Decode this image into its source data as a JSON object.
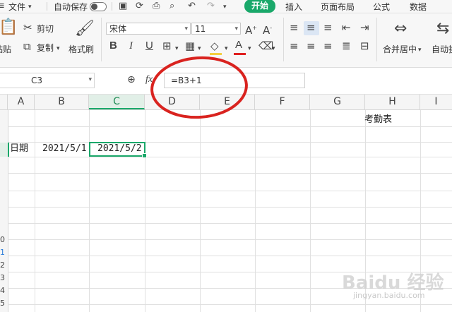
{
  "menubar": {
    "file": "文件",
    "autosave": "自动保存",
    "tabs": [
      "开始",
      "插入",
      "页面布局",
      "公式",
      "数据"
    ]
  },
  "ribbon": {
    "paste_label": "粘贴",
    "cut_label": "剪切",
    "copy_label": "复制",
    "format_painter_label": "格式刷",
    "font_name": "宋体",
    "font_size": "11",
    "bold": "B",
    "italic": "I",
    "underline": "U",
    "merge_label": "合并居中",
    "wrap_label": "自动换"
  },
  "formula_bar": {
    "cell_ref": "C3",
    "fx": "fx",
    "formula": "=B3+1"
  },
  "columns": [
    "A",
    "B",
    "C",
    "D",
    "E",
    "F",
    "G",
    "H",
    "I"
  ],
  "active_column": "C",
  "rows": [
    "",
    "",
    "",
    "",
    "",
    "",
    "",
    "",
    "",
    "0",
    "1",
    "2",
    "3",
    "4",
    "5"
  ],
  "cells": {
    "h1": "考勤表",
    "a3": "日期",
    "b3": "2021/5/1",
    "c3": "2021/5/2"
  },
  "watermark": {
    "text": "Baidu 经验",
    "sub": "jingyan.baidu.com"
  },
  "colors": {
    "accent": "#1aa86a",
    "annotation": "#d9231f"
  }
}
